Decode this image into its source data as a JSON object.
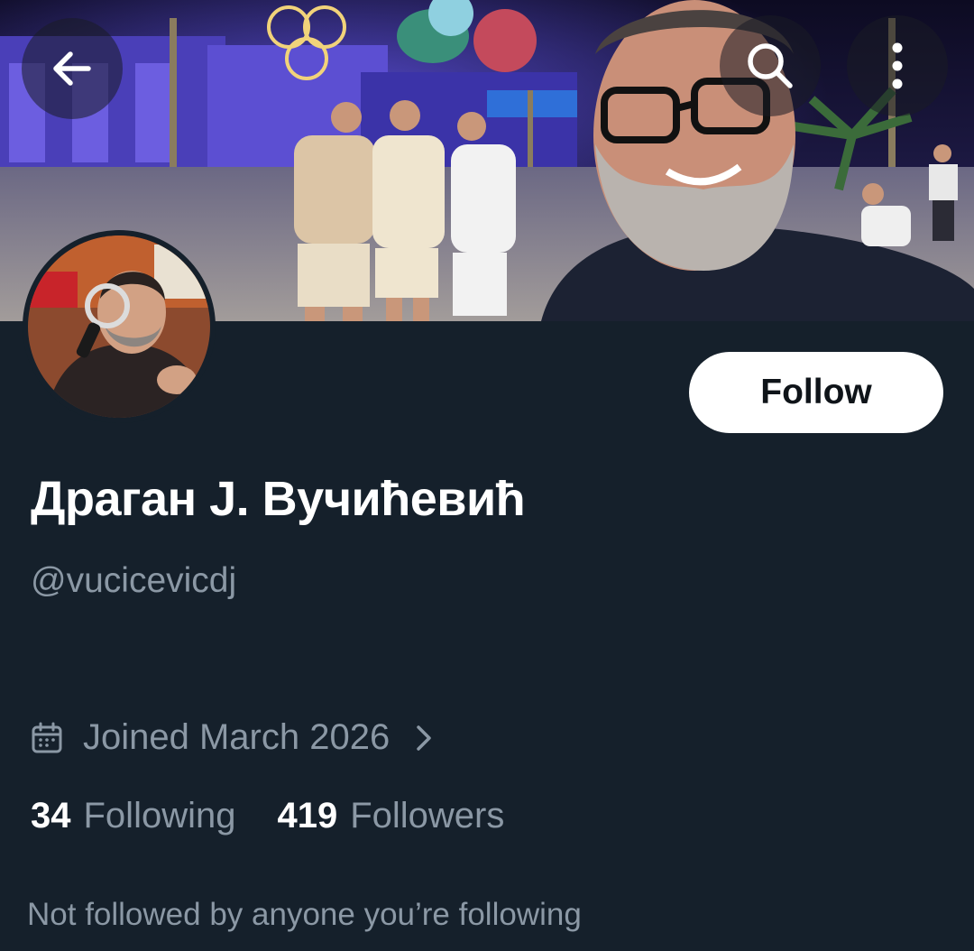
{
  "header": {
    "back_icon": "arrow-left-icon",
    "search_icon": "search-icon",
    "more_icon": "more-vertical-icon"
  },
  "banner": {
    "image": "cover-photo-night-selfie"
  },
  "profile": {
    "avatar": "profile-photo",
    "follow_label": "Follow",
    "display_name": "Драган J. Вучићевић",
    "handle": "@vucicevicdj",
    "joined_icon": "calendar-icon",
    "joined": "Joined March 2026",
    "following_count": "34",
    "following_label": "Following",
    "followers_count": "419",
    "followers_label": "Followers",
    "not_followed": "Not followed by anyone you’re following"
  },
  "colors": {
    "background": "#15202b",
    "secondary_text": "#8b98a5",
    "primary_text": "#ffffff",
    "follow_button_bg": "#ffffff",
    "follow_button_text": "#0f1419"
  }
}
